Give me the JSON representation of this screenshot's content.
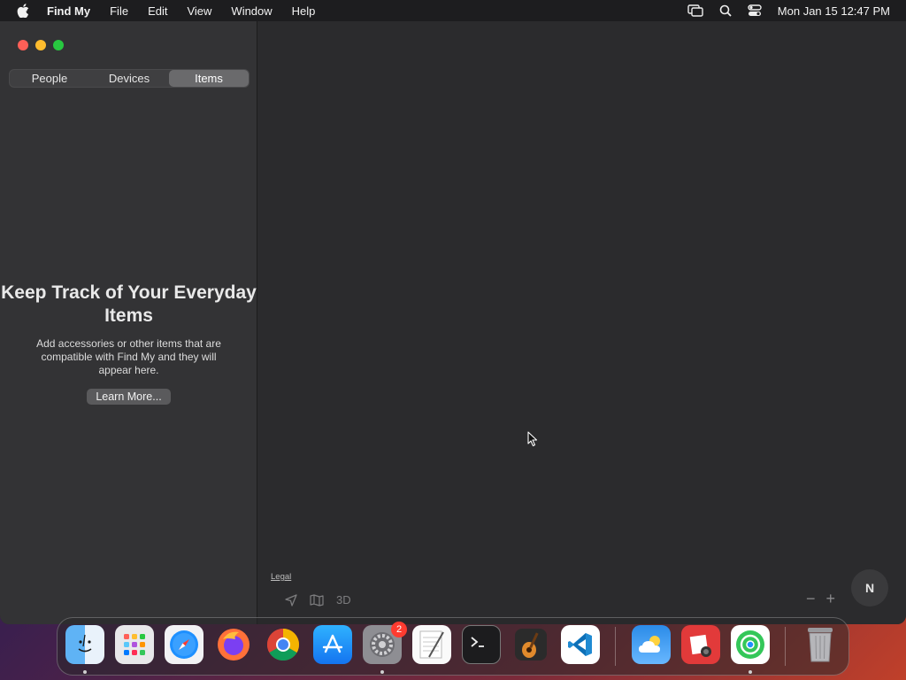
{
  "menubar": {
    "app_name": "Find My",
    "items": [
      "File",
      "Edit",
      "View",
      "Window",
      "Help"
    ],
    "clock": "Mon Jan 15  12:47 PM"
  },
  "sidebar": {
    "tabs": [
      "People",
      "Devices",
      "Items"
    ],
    "active_tab": "Items",
    "empty_title": "Keep Track of Your Everyday Items",
    "empty_body": "Add accessories or other items that are compatible with Find My and they will appear here.",
    "learn_more": "Learn More..."
  },
  "map": {
    "legal": "Legal",
    "mode_3d": "3D",
    "zoom_out": "−",
    "zoom_in": "+",
    "compass": "N"
  },
  "dock": {
    "apps": [
      "Finder",
      "Launchpad",
      "Safari",
      "Firefox",
      "Chrome",
      "App Store",
      "System Settings",
      "TextEdit",
      "Terminal",
      "GarageBand",
      "Visual Studio Code",
      "Weather",
      "Photo Booth",
      "Find My",
      "Trash"
    ],
    "settings_badge": "2"
  },
  "colors": {
    "menubar": "#1d1d1f",
    "sidebar": "#333335",
    "map": "#2b2b2d",
    "active_segment": "#6a6a6c"
  }
}
